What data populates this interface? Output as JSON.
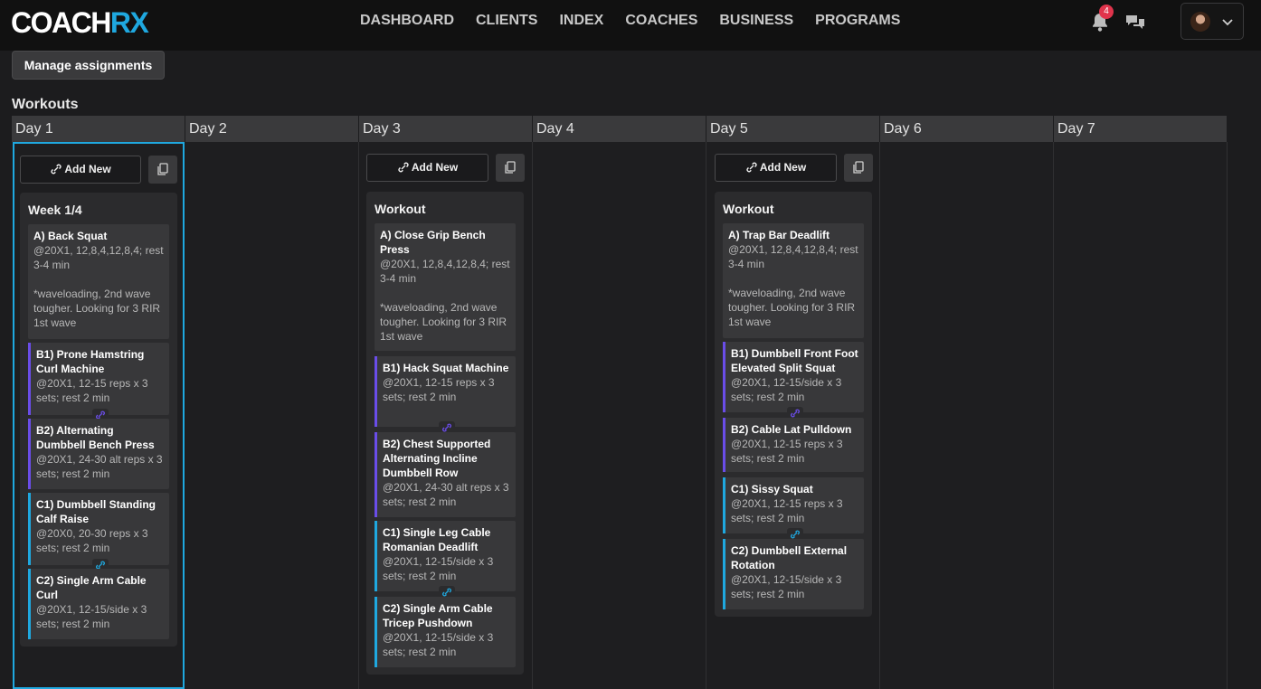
{
  "header": {
    "logo_main": "COACH",
    "logo_accent": "RX",
    "nav": [
      "DASHBOARD",
      "CLIENTS",
      "INDEX",
      "COACHES",
      "BUSINESS",
      "PROGRAMS"
    ],
    "notification_count": "4"
  },
  "toolbar": {
    "manage_label": "Manage assignments"
  },
  "section_title": "Workouts",
  "days": [
    "Day 1",
    "Day 2",
    "Day 3",
    "Day 4",
    "Day 5",
    "Day 6",
    "Day 7"
  ],
  "add_new_label": "Add New",
  "workouts": {
    "day1": {
      "title": "Week 1/4",
      "exercises": [
        {
          "name": "A) Back Squat",
          "desc": "@20X1, 12,8,4,12,8,4; rest 3-4 min\n\n*waveloading, 2nd wave tougher. Looking for 3 RIR 1st wave"
        },
        {
          "name": "B1) Prone Hamstring Curl Machine",
          "desc": "@20X1, 12-15 reps x 3 sets; rest 2 min"
        },
        {
          "name": "B2) Alternating Dumbbell Bench Press",
          "desc": "@20X1, 24-30 alt reps x 3 sets; rest 2 min"
        },
        {
          "name": "C1) Dumbbell Standing Calf Raise",
          "desc": "@20X0, 20-30 reps x 3 sets; rest 2 min"
        },
        {
          "name": "C2) Single Arm Cable Curl",
          "desc": "@20X1, 12-15/side x 3 sets; rest 2 min"
        }
      ]
    },
    "day3": {
      "title": "Workout",
      "exercises": [
        {
          "name": "A) Close Grip Bench Press",
          "desc": "@20X1, 12,8,4,12,8,4; rest 3-4 min\n\n*waveloading, 2nd wave tougher. Looking for 3 RIR 1st wave"
        },
        {
          "name": "B1) Hack Squat Machine",
          "desc": "@20X1, 12-15 reps x 3 sets; rest 2 min"
        },
        {
          "name": "B2) Chest Supported Alternating Incline Dumbbell Row",
          "desc": "@20X1, 24-30 alt reps x 3 sets; rest 2 min"
        },
        {
          "name": "C1) Single Leg Cable Romanian Deadlift",
          "desc": "@20X1, 12-15/side x 3 sets; rest 2 min"
        },
        {
          "name": "C2) Single Arm Cable Tricep Pushdown",
          "desc": "@20X1, 12-15/side x 3 sets; rest 2 min"
        }
      ]
    },
    "day5": {
      "title": "Workout",
      "exercises": [
        {
          "name": "A) Trap Bar Deadlift",
          "desc": "@20X1, 12,8,4,12,8,4; rest 3-4 min\n\n*waveloading, 2nd wave tougher. Looking for 3 RIR 1st wave"
        },
        {
          "name": "B1) Dumbbell Front Foot Elevated Split Squat",
          "desc": "@20X1, 12-15/side x 3 sets; rest 2 min"
        },
        {
          "name": "B2) Cable Lat Pulldown",
          "desc": "@20X1, 12-15 reps x 3 sets; rest 2 min"
        },
        {
          "name": "C1) Sissy Squat",
          "desc": "@20X1, 12-15 reps x 3 sets; rest 2 min"
        },
        {
          "name": "C2) Dumbbell External Rotation",
          "desc": "@20X1, 12-15/side x 3 sets; rest 2 min"
        }
      ]
    }
  },
  "colors": {
    "brand_accent": "#1fa8df",
    "superset_b": "#6a4de8",
    "superset_c": "#1fa8df",
    "badge": "#e0344c"
  }
}
